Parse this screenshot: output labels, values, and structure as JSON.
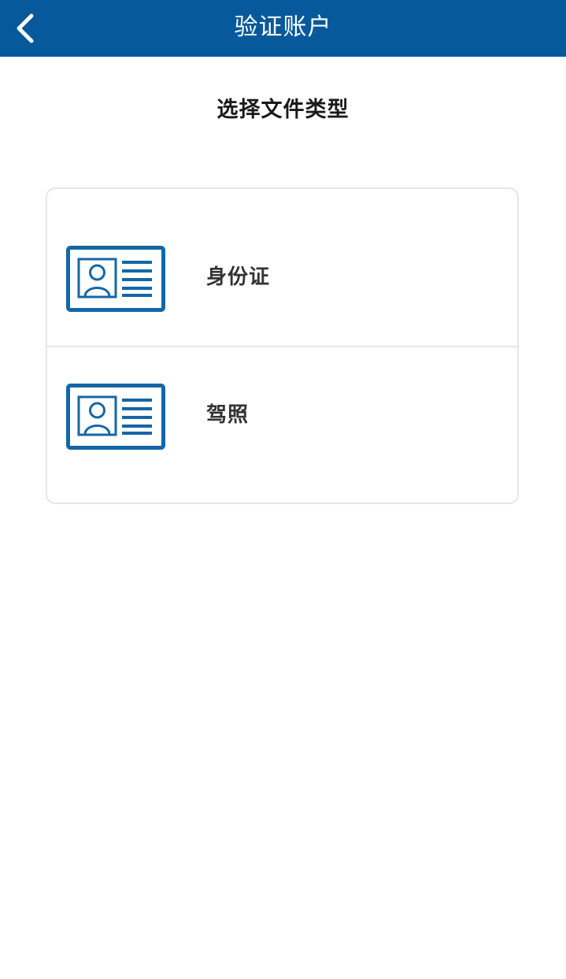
{
  "header": {
    "title": "验证账户",
    "back_icon": "chevron-left-icon",
    "background_color": "#06599a",
    "text_color": "#ffffff"
  },
  "main": {
    "heading": "选择文件类型",
    "document_types": [
      {
        "label": "身份证",
        "icon": "id-card-icon"
      },
      {
        "label": "驾照",
        "icon": "id-card-icon"
      }
    ]
  },
  "colors": {
    "icon_blue": "#1467a6",
    "card_border": "#e6e6e6",
    "label_text": "#333333"
  }
}
